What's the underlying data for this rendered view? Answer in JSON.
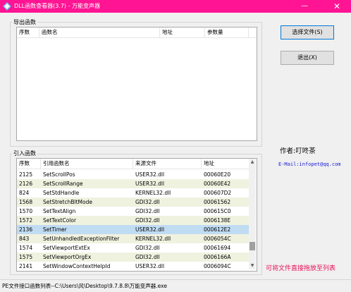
{
  "window": {
    "title": "DLL函数查看器(3.7) - 万能变声器",
    "minimize": "—",
    "close": "✕"
  },
  "exports": {
    "group_label": "导出函数",
    "columns": [
      "序数",
      "函数名",
      "地址",
      "参数量"
    ]
  },
  "imports": {
    "group_label": "引入函数",
    "columns": [
      "序数",
      "引用函数名",
      "来源文件",
      "地址"
    ],
    "rows": [
      {
        "ord": "2125",
        "name": "SetScrollPos",
        "file": "USER32.dll",
        "addr": "00060E20"
      },
      {
        "ord": "2126",
        "name": "SetScrollRange",
        "file": "USER32.dll",
        "addr": "00060E42"
      },
      {
        "ord": "824",
        "name": "SetStdHandle",
        "file": "KERNEL32.dll",
        "addr": "000607D2"
      },
      {
        "ord": "1568",
        "name": "SetStretchBltMode",
        "file": "GDI32.dll",
        "addr": "00061562"
      },
      {
        "ord": "1570",
        "name": "SetTextAlign",
        "file": "GDI32.dll",
        "addr": "000615C0"
      },
      {
        "ord": "1572",
        "name": "SetTextColor",
        "file": "GDI32.dll",
        "addr": "0006138E"
      },
      {
        "ord": "2136",
        "name": "SetTimer",
        "file": "USER32.dll",
        "addr": "000612E2"
      },
      {
        "ord": "843",
        "name": "SetUnhandledExceptionFilter",
        "file": "KERNEL32.dll",
        "addr": "0006054C"
      },
      {
        "ord": "1574",
        "name": "SetViewportExtEx",
        "file": "GDI32.dll",
        "addr": "00061694"
      },
      {
        "ord": "1575",
        "name": "SetViewportOrgEx",
        "file": "GDI32.dll",
        "addr": "0006166A"
      },
      {
        "ord": "2141",
        "name": "SetWindowContextHelpId",
        "file": "USER32.dll",
        "addr": "0006094C"
      }
    ]
  },
  "buttons": {
    "select_file": "选择文件(S)",
    "exit": "退出(X)"
  },
  "author": "作者:叮咚茶",
  "email": "E-Mail:infopet@qq.com",
  "hint": "可将文件直接拖放至列表",
  "status": "PE文件接口函数列表--C:\\Users\\风\\Desktop\\9.7.8.8\\万能变声器.exe"
}
